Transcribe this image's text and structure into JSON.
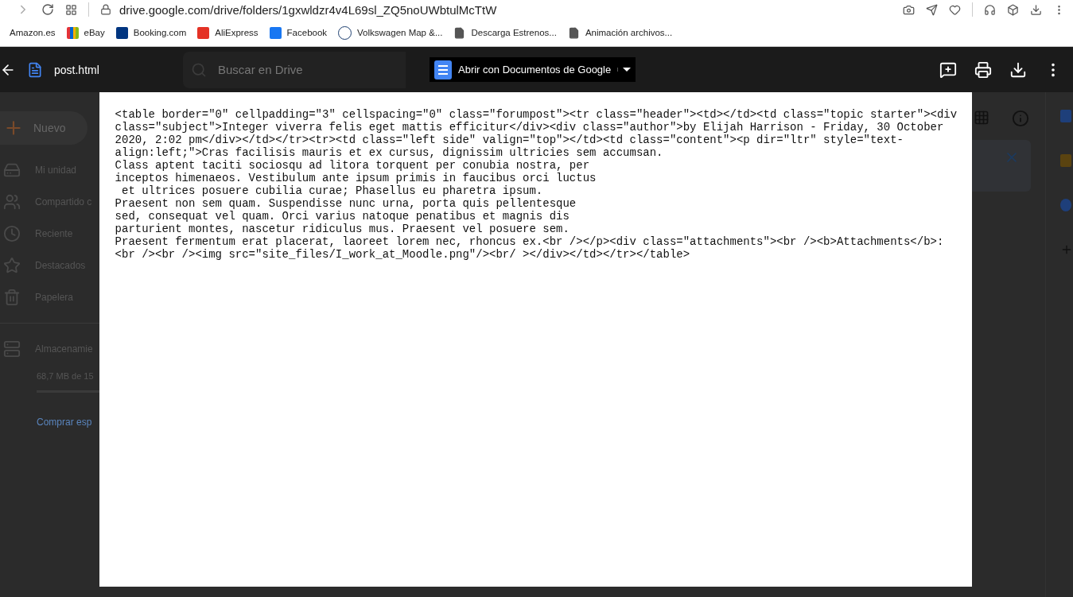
{
  "browser": {
    "url": "drive.google.com/drive/folders/1gxwldzr4v4L69sl_ZQ5noUWbtulMcTtW",
    "bookmarks": [
      {
        "label": "Amazon.es",
        "kind": "cut"
      },
      {
        "label": "eBay",
        "kind": "ebay"
      },
      {
        "label": "Booking.com",
        "kind": "booking"
      },
      {
        "label": "AliExpress",
        "kind": "aliexpress"
      },
      {
        "label": "Facebook",
        "kind": "facebook"
      },
      {
        "label": "Volkswagen Map &...",
        "kind": "vw"
      },
      {
        "label": "Descarga Estrenos...",
        "kind": "page"
      },
      {
        "label": "Animación archivos...",
        "kind": "page"
      }
    ]
  },
  "viewer": {
    "file_name": "post.html",
    "open_with_button": "Abrir con Documentos de Google"
  },
  "drive_background": {
    "search_placeholder": "Buscar en Drive",
    "new_button": "Nuevo",
    "nav_items": [
      {
        "label": "Mi unidad",
        "kind": "drive"
      },
      {
        "label": "Compartido c",
        "kind": "shared"
      },
      {
        "label": "Reciente",
        "kind": "recent"
      },
      {
        "label": "Destacados",
        "kind": "starred"
      },
      {
        "label": "Papelera",
        "kind": "trash"
      }
    ],
    "storage_label": "Almacenamie",
    "storage_usage": "68,7 MB de 15",
    "buy_storage_link": "Comprar esp"
  },
  "document": {
    "text": "<table border=\"0\" cellpadding=\"3\" cellspacing=\"0\" class=\"forumpost\"><tr class=\"header\"><td></td><td class=\"topic starter\"><div class=\"subject\">Integer viverra felis eget mattis efficitur</div><div class=\"author\">by Elijah Harrison - Friday, 30 October 2020, 2:02 pm</div></td></tr><tr><td class=\"left side\" valign=\"top\"></td><td class=\"content\"><p dir=\"ltr\" style=\"text-align:left;\">Cras facilisis mauris et ex cursus, dignissim ultricies sem accumsan.\nClass aptent taciti sociosqu ad litora torquent per conubia nostra, per\ninceptos himenaeos. Vestibulum ante ipsum primis in faucibus orci luctus\n et ultrices posuere cubilia curae; Phasellus eu pharetra ipsum.\nPraesent non sem quam. Suspendisse nunc urna, porta quis pellentesque\nsed, consequat vel quam. Orci varius natoque penatibus et magnis dis\nparturient montes, nascetur ridiculus mus. Praesent vel posuere sem.\nPraesent fermentum erat placerat, laoreet lorem nec, rhoncus ex.<br /></p><div class=\"attachments\"><br /><b>Attachments</b>:<br /><br /><img src=\"site_files/I_work_at_Moodle.png\"/><br/ ></div></td></tr></table>"
  }
}
